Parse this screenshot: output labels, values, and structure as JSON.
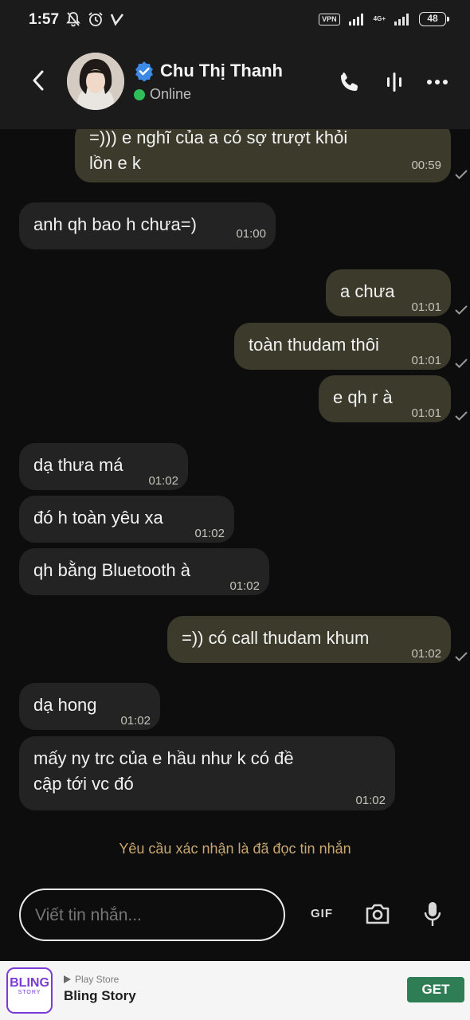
{
  "status_bar": {
    "time": "1:57",
    "left_icons": [
      "bell-off-icon",
      "alarm-icon",
      "check-logo-icon"
    ],
    "vpn_label": "VPN",
    "network_label": "4G+",
    "battery": "48"
  },
  "header": {
    "contact_name": "Chu Thị Thanh",
    "status": "Online",
    "verified": true,
    "actions": [
      "phone-icon",
      "voice-wave-icon",
      "more-icon"
    ]
  },
  "messages": [
    {
      "dir": "out",
      "text": "=))) e nghĩ của a có sợ trượt khỏi\nlồn e k",
      "time": "00:59"
    },
    {
      "dir": "in",
      "text": "anh qh bao h chưa=)",
      "time": "01:00"
    },
    {
      "dir": "out",
      "text": "a chưa",
      "time": "01:01"
    },
    {
      "dir": "out",
      "text": "toàn thudam thôi",
      "time": "01:01"
    },
    {
      "dir": "out",
      "text": "e qh r à",
      "time": "01:01"
    },
    {
      "dir": "in",
      "text": "dạ thưa má",
      "time": "01:02"
    },
    {
      "dir": "in",
      "text": "đó h toàn yêu xa",
      "time": "01:02"
    },
    {
      "dir": "in",
      "text": "qh bằng Bluetooth à",
      "time": "01:02"
    },
    {
      "dir": "out",
      "text": "=)) có call thudam khum",
      "time": "01:02"
    },
    {
      "dir": "in",
      "text": "dạ hong",
      "time": "01:02"
    },
    {
      "dir": "in",
      "text": "mấy ny trc của e hầu như k có đề\ncập tới vc đó",
      "time": "01:02"
    }
  ],
  "read_receipt_notice": "Yêu cầu xác nhận là đã đọc tin nhắn",
  "composer": {
    "placeholder": "Viết tin nhắn...",
    "gif_label": "GIF"
  },
  "ad": {
    "logo_text": "BLING",
    "logo_sub": "STORY",
    "store": "Play Store",
    "title": "Bling Story",
    "cta": "GET"
  }
}
